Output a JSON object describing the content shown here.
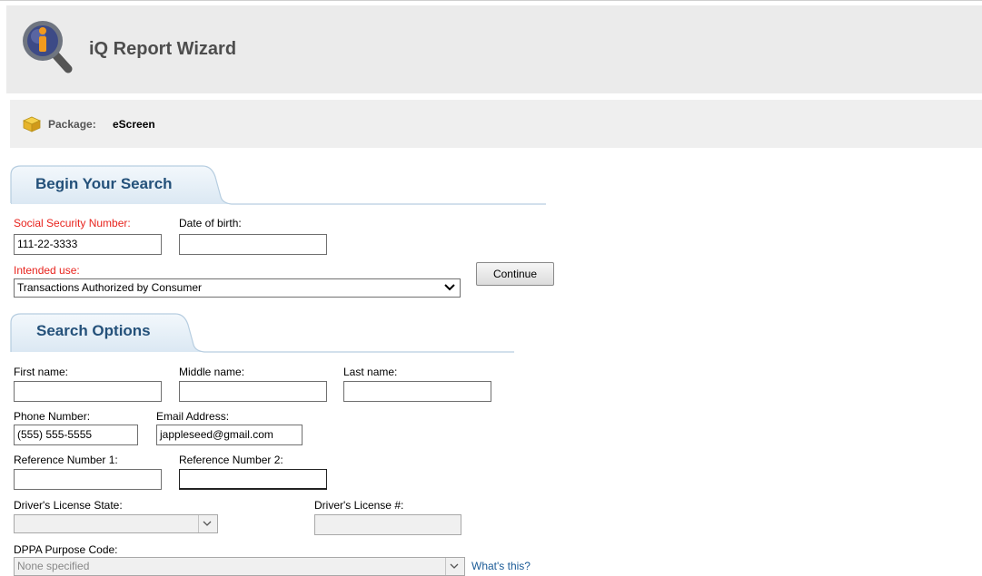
{
  "app": {
    "title": "iQ Report Wizard",
    "logo_icon": "magnifier-info-icon"
  },
  "package": {
    "label": "Package:",
    "value": "eScreen",
    "icon": "package-box-icon"
  },
  "begin_search": {
    "tab_label": "Begin Your Search",
    "ssn": {
      "label": "Social Security Number:",
      "value": "111-22-3333"
    },
    "dob": {
      "label": "Date of birth:",
      "value": ""
    },
    "intended_use": {
      "label": "Intended use:",
      "selected": "Transactions Authorized by Consumer"
    },
    "continue_label": "Continue"
  },
  "search_options": {
    "tab_label": "Search Options",
    "first_name": {
      "label": "First name:",
      "value": ""
    },
    "middle_name": {
      "label": "Middle name:",
      "value": ""
    },
    "last_name": {
      "label": "Last name:",
      "value": ""
    },
    "phone": {
      "label": "Phone Number:",
      "value": "(555) 555-5555"
    },
    "email": {
      "label": "Email Address:",
      "value": "jappleseed@gmail.com"
    },
    "ref1": {
      "label": "Reference Number 1:",
      "value": ""
    },
    "ref2": {
      "label": "Reference Number 2:",
      "value": ""
    },
    "dl_state": {
      "label": "Driver's License State:",
      "selected": ""
    },
    "dl_number": {
      "label": "Driver's License #:",
      "value": ""
    },
    "dppa": {
      "label": "DPPA Purpose Code:",
      "selected": "None specified",
      "help_link": "What's this?"
    }
  },
  "colors": {
    "required_label": "#e8231d",
    "tab_text": "#24517a",
    "link": "#1a5a96"
  }
}
